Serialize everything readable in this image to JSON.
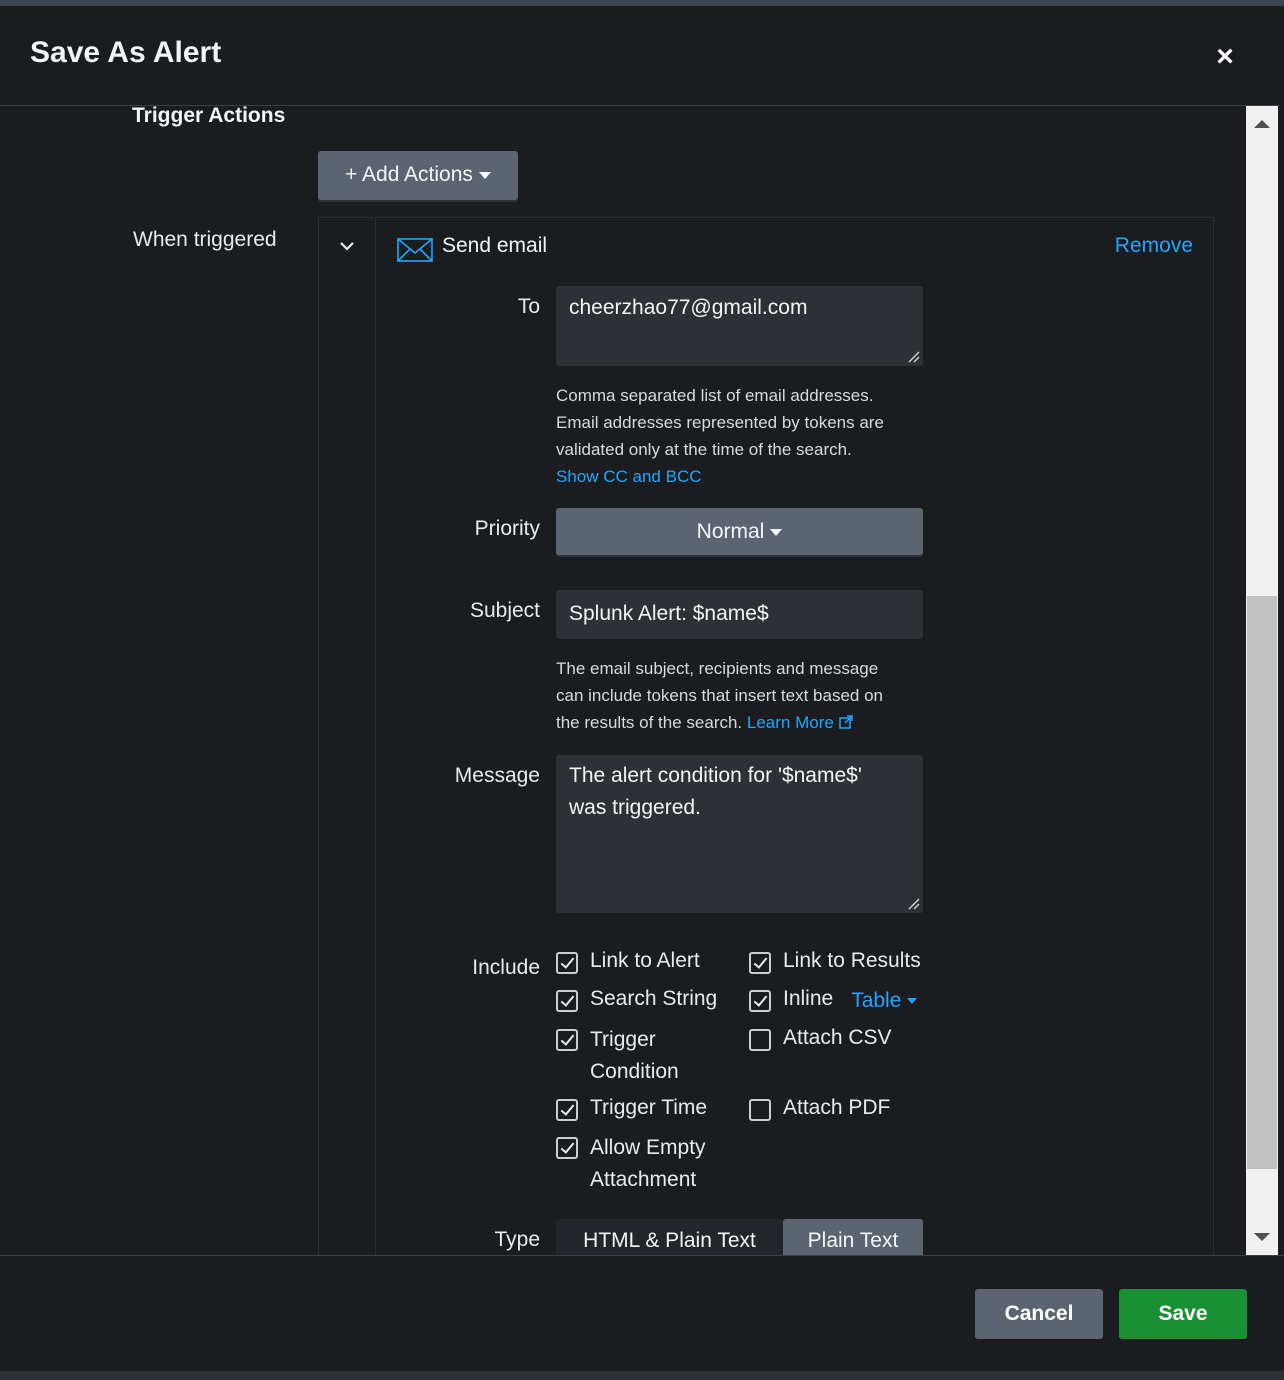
{
  "dialog": {
    "title": "Save As Alert",
    "close_label": "×"
  },
  "trigger_actions": {
    "heading": "Trigger Actions",
    "add_actions_label": "+ Add Actions",
    "when_triggered_label": "When triggered"
  },
  "send_email": {
    "title": "Send email",
    "remove_label": "Remove",
    "to_label": "To",
    "to_value": "cheerzhao77@gmail.com",
    "to_help_lines": [
      "Comma separated list of email addresses.",
      "Email addresses represented by tokens are",
      "validated only at the time of the search."
    ],
    "show_cc_bcc": "Show CC and BCC",
    "priority_label": "Priority",
    "priority_value": "Normal",
    "subject_label": "Subject",
    "subject_value": "Splunk Alert: $name$",
    "subject_help_lines": [
      "The email subject, recipients and message",
      "can include tokens that insert text based on",
      "the results of the search."
    ],
    "learn_more": "Learn More",
    "message_label": "Message",
    "message_line1": "The alert condition for '$name$'",
    "message_line2": "was triggered.",
    "include_label": "Include",
    "include_options": [
      {
        "label": "Link to Alert",
        "checked": true
      },
      {
        "label": "Link to Results",
        "checked": true
      },
      {
        "label": "Search String",
        "checked": true
      },
      {
        "label": "Inline",
        "checked": true
      },
      {
        "label": "Trigger",
        "label2": "Condition",
        "checked": true
      },
      {
        "label": "Attach CSV",
        "checked": false
      },
      {
        "label": "Trigger Time",
        "checked": true
      },
      {
        "label": "Attach PDF",
        "checked": false
      },
      {
        "label": "Allow Empty",
        "label2": "Attachment",
        "checked": true
      }
    ],
    "inline_format": "Table",
    "type_label": "Type",
    "type_options": [
      "HTML & Plain Text",
      "Plain Text"
    ],
    "type_selected": "Plain Text"
  },
  "footer": {
    "cancel_label": "Cancel",
    "save_label": "Save"
  },
  "colors": {
    "link": "#1ea7fd",
    "save_button": "#1a9035",
    "secondary_button": "#5b6470",
    "background": "#1a1c20"
  }
}
